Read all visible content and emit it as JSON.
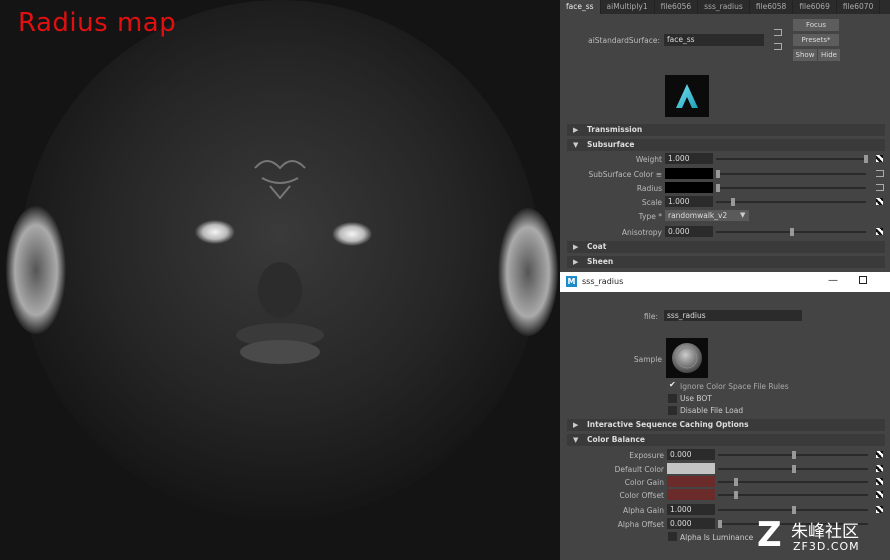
{
  "viewport": {
    "title": "Radius map"
  },
  "tabs": [
    "face_ss",
    "aiMultiply1",
    "file6056",
    "sss_radius",
    "file6058",
    "file6069",
    "file6070"
  ],
  "node": {
    "type_label": "aiStandardSurface:",
    "name": "face_ss"
  },
  "buttons": {
    "focus": "Focus",
    "presets": "Presets*",
    "show": "Show",
    "hide": "Hide"
  },
  "sections": {
    "transmission": "Transmission",
    "subsurface": "Subsurface",
    "coat": "Coat",
    "sheen": "Sheen"
  },
  "subsurface": {
    "weight": {
      "label": "Weight",
      "value": "1.000",
      "level": 1.0
    },
    "color": {
      "label": "SubSurface Color ≡",
      "color": "#000000"
    },
    "radius": {
      "label": "Radius",
      "color": "#000000"
    },
    "scale": {
      "label": "Scale",
      "value": "1.000",
      "level": 0.1
    },
    "type": {
      "label": "Type *",
      "value": "randomwalk_v2"
    },
    "anisotropy": {
      "label": "Anisotropy",
      "value": "0.000",
      "level": 0.5
    }
  },
  "window": {
    "title": "sss_radius",
    "file_label": "file:",
    "file_value": "sss_radius",
    "sample_label": "Sample",
    "checkboxes": [
      {
        "label": "Ignore Color Space File Rules",
        "checked": true
      },
      {
        "label": "Use BOT",
        "checked": false
      },
      {
        "label": "Disable File Load",
        "checked": false
      }
    ],
    "sections": {
      "caching": "Interactive Sequence Caching Options",
      "color_balance": "Color Balance"
    },
    "color_balance": {
      "exposure": {
        "label": "Exposure",
        "value": "0.000",
        "level": 0.5
      },
      "default_color": {
        "label": "Default Color",
        "color": "#c4c4c4",
        "level": 0.5
      },
      "color_gain": {
        "label": "Color Gain",
        "color": "#6b2b2b",
        "level": 0.12
      },
      "color_offset": {
        "label": "Color Offset",
        "color": "#6b2b2b",
        "level": 0.12
      },
      "alpha_gain": {
        "label": "Alpha Gain",
        "value": "1.000",
        "level": 0.5
      },
      "alpha_offset": {
        "label": "Alpha Offset",
        "value": "0.000",
        "level": 0.02
      },
      "alpha_is_luminance": {
        "label": "Alpha Is Luminance",
        "checked": false
      }
    }
  },
  "watermark": {
    "cn": "朱峰社区",
    "url": "ZF3D.COM"
  }
}
